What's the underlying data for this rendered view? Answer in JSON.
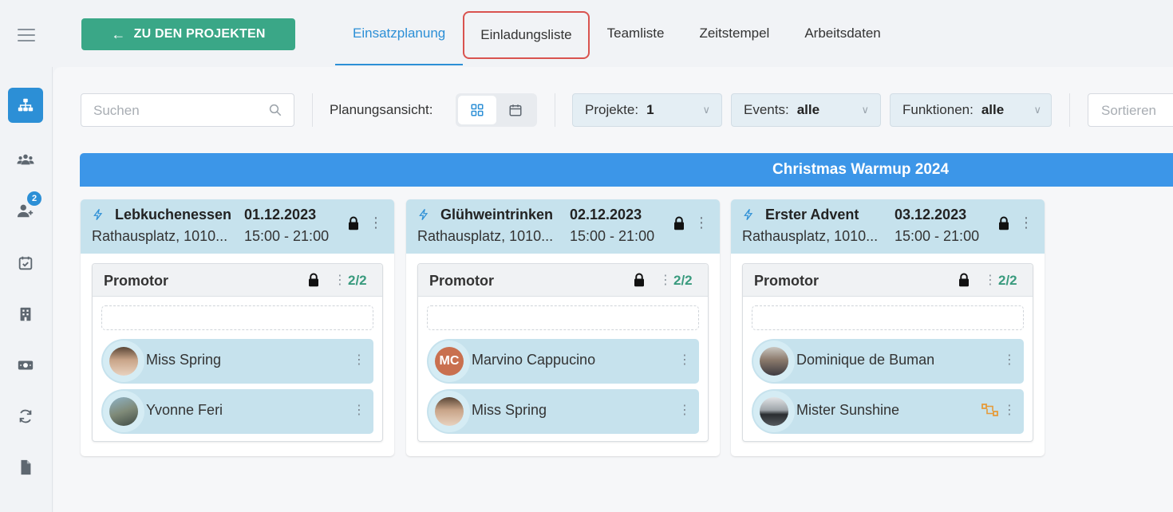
{
  "topbar": {
    "back_button": "ZU DEN PROJEKTEN",
    "tabs": [
      "Einsatzplanung",
      "Einladungsliste",
      "Teamliste",
      "Zeitstempel",
      "Arbeitsdaten"
    ],
    "active_tab": "Einsatzplanung",
    "highlighted_tab": "Einladungsliste"
  },
  "sidebar": {
    "items": [
      "org-chart",
      "team",
      "add-person",
      "calendar-check",
      "building",
      "money",
      "sync",
      "document"
    ],
    "badge": "2"
  },
  "toolbar": {
    "search_placeholder": "Suchen",
    "view_label": "Planungsansicht:",
    "filters": [
      {
        "label": "Projekte:",
        "value": "1"
      },
      {
        "label": "Events:",
        "value": "alle"
      },
      {
        "label": "Funktionen:",
        "value": "alle"
      }
    ],
    "sort_placeholder": "Sortieren"
  },
  "project": {
    "title": "Christmas Warmup 2024"
  },
  "events": [
    {
      "name": "Lebkuchenessen",
      "date": "01.12.2023",
      "address": "Rathausplatz, 1010...",
      "time": "15:00 - 21:00",
      "function": "Promotor",
      "count": "2/2",
      "people": [
        {
          "name": "Miss Spring",
          "initials": ""
        },
        {
          "name": "Yvonne Feri",
          "initials": ""
        }
      ]
    },
    {
      "name": "Glühweintrinken",
      "date": "02.12.2023",
      "address": "Rathausplatz, 1010...",
      "time": "15:00 - 21:00",
      "function": "Promotor",
      "count": "2/2",
      "people": [
        {
          "name": "Marvino Cappucino",
          "initials": "MC"
        },
        {
          "name": "Miss Spring",
          "initials": ""
        }
      ]
    },
    {
      "name": "Erster Advent",
      "date": "03.12.2023",
      "address": "Rathausplatz, 1010...",
      "time": "15:00 - 21:00",
      "function": "Promotor",
      "count": "2/2",
      "people": [
        {
          "name": "Dominique de Buman",
          "initials": ""
        },
        {
          "name": "Mister Sunshine",
          "initials": ""
        }
      ]
    }
  ],
  "colors": {
    "accent": "#2c8fd6",
    "back_button": "#3aa787",
    "banner": "#3c96e8",
    "card_header": "#c6e2ed",
    "highlight": "#d9534f"
  }
}
